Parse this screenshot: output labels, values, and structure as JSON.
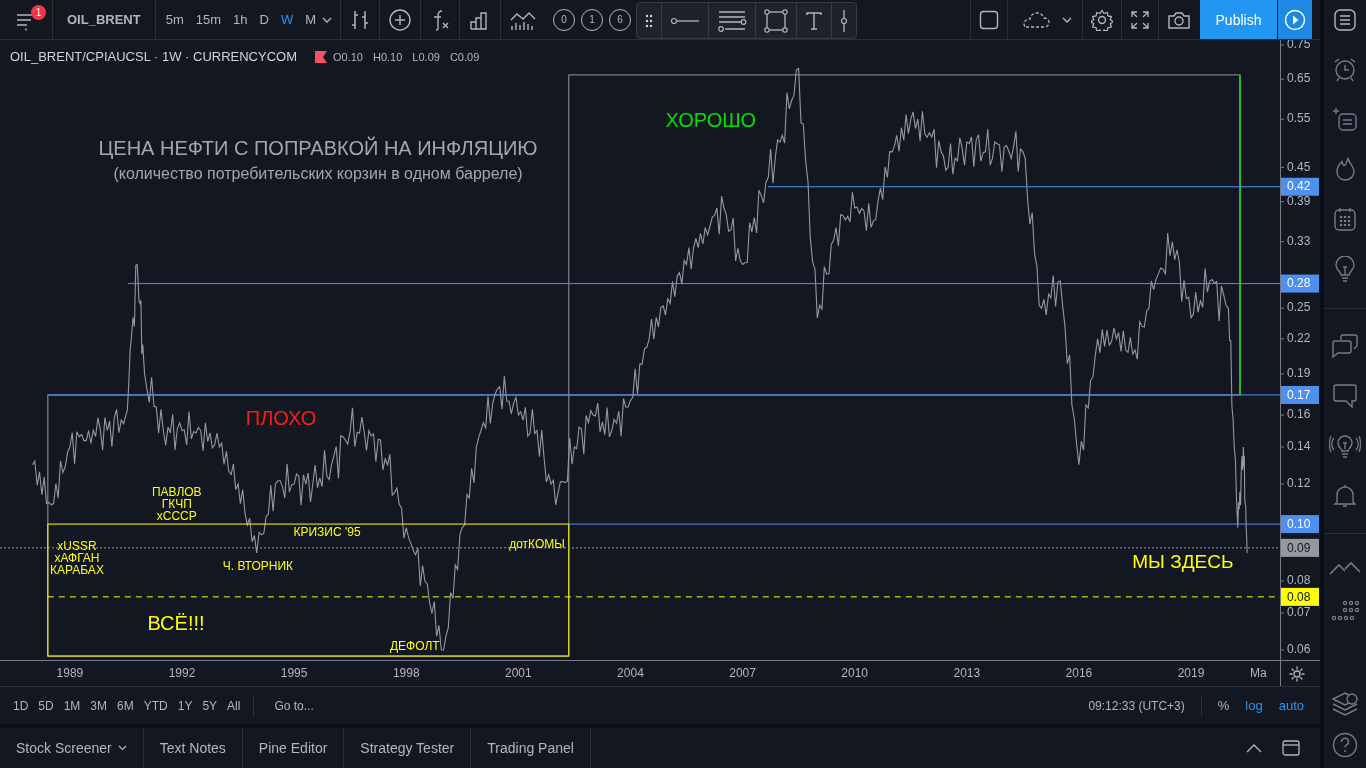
{
  "toolbar": {
    "notification_count": "1",
    "symbol": "OIL_BRENT",
    "intervals": [
      {
        "label": "5m",
        "selected": false
      },
      {
        "label": "15m",
        "selected": false
      },
      {
        "label": "1h",
        "selected": false
      },
      {
        "label": "D",
        "selected": false
      },
      {
        "label": "W",
        "selected": true
      },
      {
        "label": "M",
        "selected": false
      }
    ],
    "counters": [
      "0",
      "1",
      "6"
    ],
    "publish": "Publish"
  },
  "legend": {
    "title": "OIL_BRENT/CPIAUCSL · 1W · CURRENCYCOM",
    "ohlc": [
      {
        "label": "O",
        "value": "0.10"
      },
      {
        "label": "H",
        "value": "0.10"
      },
      {
        "label": "L",
        "value": "0.09"
      },
      {
        "label": "C",
        "value": "0.09"
      }
    ]
  },
  "chart": {
    "time_axis": [
      "1989",
      "1992",
      "1995",
      "1998",
      "2001",
      "2004",
      "2007",
      "2010",
      "2013",
      "2016",
      "2019",
      "Ma"
    ],
    "price_axis": [
      "0.75",
      "0.65",
      "0.55",
      "0.45",
      "0.39",
      "0.33",
      "0.25",
      "0.22",
      "0.19",
      "0.16",
      "0.14",
      "0.12",
      "0.08",
      "0.07",
      "0.06"
    ],
    "price_labels": [
      {
        "kind": "level",
        "label": "0.42",
        "color": "#4f8ff0"
      },
      {
        "kind": "level",
        "label": "0.28",
        "color": "#4f8ff0"
      },
      {
        "kind": "level",
        "label": "0.17",
        "color": "#4f8ff0"
      },
      {
        "kind": "level",
        "label": "0.10",
        "color": "#4f8ff0"
      },
      {
        "kind": "last_price",
        "label": "0.09",
        "color": "#9598a1"
      },
      {
        "kind": "alert",
        "label": "0.08",
        "color": "#ffff00"
      }
    ],
    "drawings": [
      {
        "kind": "title",
        "text": "ЦЕНА НЕФТИ С ПОПРАВКОЙ НА ИНФЛЯЦИЮ",
        "color": "#a3a6af"
      },
      {
        "kind": "subtitle",
        "text": "(количество потребительских корзин в одном барреле)",
        "color": "#a3a6af"
      },
      {
        "kind": "label",
        "text": "ХОРОШО",
        "color": "#00e000"
      },
      {
        "kind": "label",
        "text": "ПЛОХО",
        "color": "#ff1a1a"
      },
      {
        "kind": "note",
        "text": "ПАВЛОВ\nГКЧП\nxСССР",
        "color": "#ffff00"
      },
      {
        "kind": "note",
        "text": "xUSSR\nxАФГАН\nКАРАБАХ",
        "color": "#ffff00"
      },
      {
        "kind": "note",
        "text": "Ч. ВТОРНИК",
        "color": "#ffff00"
      },
      {
        "kind": "note",
        "text": "КРИЗИС '95",
        "color": "#ffff00"
      },
      {
        "kind": "note",
        "text": "дотКОМЫ",
        "color": "#ffff00"
      },
      {
        "kind": "note",
        "text": "ДЕФОЛТ",
        "color": "#ffff00"
      },
      {
        "kind": "label",
        "text": "ВСЁ!!!",
        "color": "#ffff00"
      },
      {
        "kind": "callout",
        "text": "МЫ ЗДЕСЬ",
        "color": "#ffff00"
      }
    ]
  },
  "range_bar": {
    "ranges": [
      "1D",
      "5D",
      "1M",
      "3M",
      "6M",
      "YTD",
      "1Y",
      "5Y",
      "All"
    ],
    "goto": "Go to...",
    "time": "09:12:33 (UTC+3)",
    "scale_options": [
      {
        "label": "%",
        "selected": false
      },
      {
        "label": "log",
        "selected": true
      },
      {
        "label": "auto",
        "selected": true
      }
    ]
  },
  "bottom_tabs": [
    {
      "label": "Stock Screener",
      "dropdown": true
    },
    {
      "label": "Text Notes",
      "dropdown": false
    },
    {
      "label": "Pine Editor",
      "dropdown": false
    },
    {
      "label": "Strategy Tester",
      "dropdown": false
    },
    {
      "label": "Trading Panel",
      "dropdown": false
    }
  ]
}
